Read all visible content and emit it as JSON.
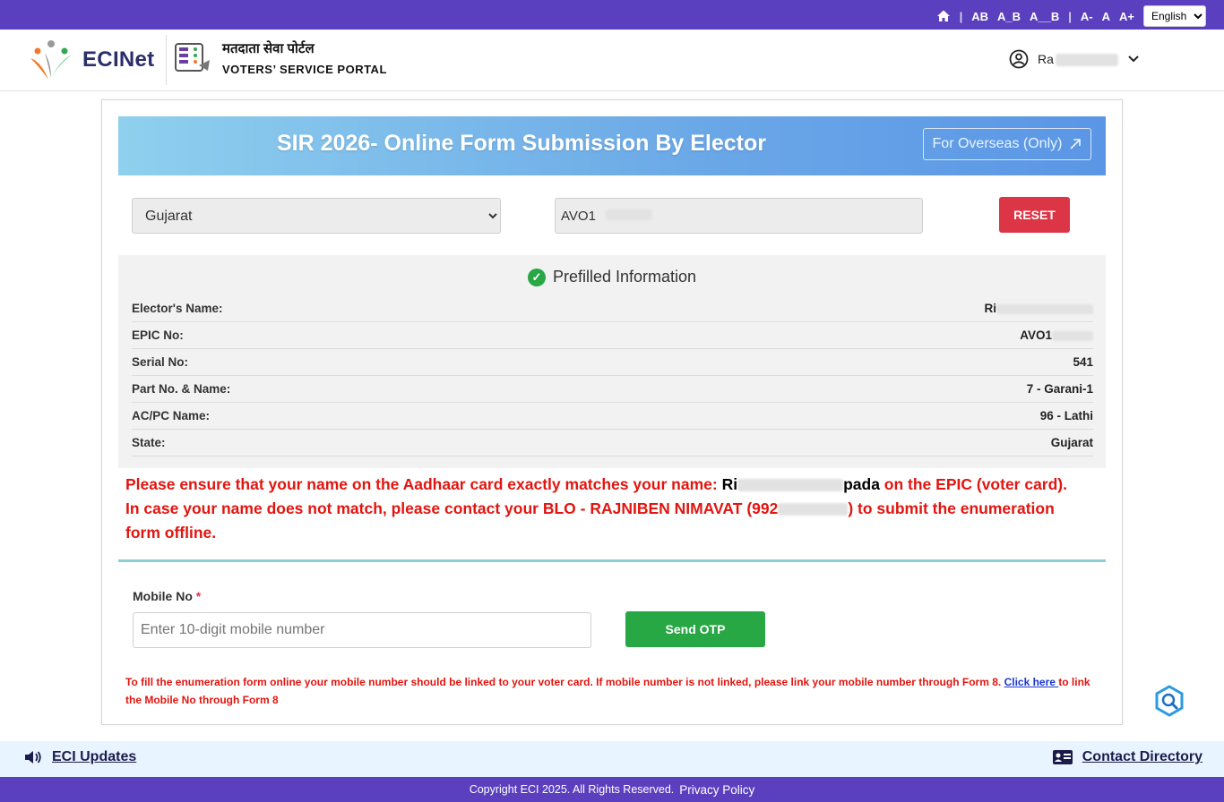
{
  "topbar": {
    "text_sizes": [
      "AB",
      "A_B",
      "A__B"
    ],
    "font_sizes": [
      "A-",
      "A",
      "A+"
    ],
    "language": "English"
  },
  "header": {
    "brand": "ECINet",
    "portal_hindi": "मतदाता सेवा पोर्टल",
    "portal_english": "VOTERS’ SERVICE PORTAL",
    "user_prefix": "Ra"
  },
  "form": {
    "banner_title": "SIR 2026- Online Form Submission By Elector",
    "overseas_label": "For Overseas (Only)",
    "state_value": "Gujarat",
    "epic_value": "AVO1",
    "reset_label": "RESET"
  },
  "prefill": {
    "title": "Prefilled Information",
    "rows": [
      {
        "label": "Elector's Name:",
        "value": "Ri"
      },
      {
        "label": "EPIC No:",
        "value": "AVO1"
      },
      {
        "label": "Serial No:",
        "value": "541"
      },
      {
        "label": "Part No. & Name:",
        "value": "7 - Garani-1"
      },
      {
        "label": "AC/PC Name:",
        "value": "96 - Lathi"
      },
      {
        "label": "State:",
        "value": "Gujarat"
      }
    ]
  },
  "warning": {
    "line1_pre": "Please ensure that your name on the Aadhaar card exactly matches your name: ",
    "name_start": "Ri",
    "name_end": "pada",
    "line1_post": " on the EPIC (voter card).",
    "line2_pre": "In case your name does not match, please contact your BLO - RAJNIBEN NIMAVAT (992",
    "line2_post": ") to submit the enumeration form offline."
  },
  "mobile": {
    "label": "Mobile No",
    "required_mark": "*",
    "placeholder": "Enter 10-digit mobile number",
    "send_otp": "Send OTP"
  },
  "note": {
    "text": "To fill the enumeration form online your mobile number should be linked to your voter card. If mobile number is not linked, please link your mobile number through Form 8. ",
    "link": "Click here ",
    "text_after": "to link the Mobile No through Form 8"
  },
  "footer": {
    "updates": "ECI Updates",
    "contact": "Contact Directory",
    "copyright": "Copyright ECI 2025. All Rights Reserved.",
    "privacy": "Privacy Policy"
  },
  "colors": {
    "topbar": "#5a40bf",
    "reset": "#dc3545",
    "otp": "#28a745",
    "warning": "#e2150f"
  }
}
